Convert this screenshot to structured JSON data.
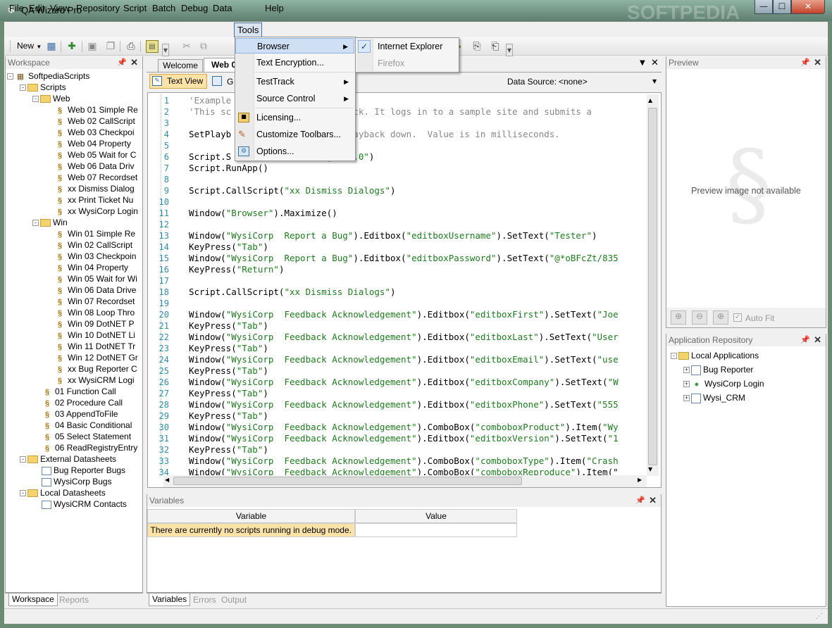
{
  "window": {
    "title": "QA Wizard Pro",
    "watermark": "SOFTPEDIA"
  },
  "menubar": [
    "File",
    "Edit",
    "View",
    "Repository",
    "Script",
    "Batch",
    "Debug",
    "Data",
    "Tools",
    "Help"
  ],
  "toolbar": {
    "new_label": "New"
  },
  "workspace": {
    "title": "Workspace",
    "tabs": [
      "Workspace",
      "Reports"
    ],
    "tree": [
      {
        "label": "SoftpediaScripts",
        "level": 0,
        "icon": "project",
        "exp": "-"
      },
      {
        "label": "Scripts",
        "level": 1,
        "icon": "folder",
        "exp": "-"
      },
      {
        "label": "Web",
        "level": 2,
        "icon": "folder",
        "exp": "-"
      },
      {
        "label": "Web 01 Simple Re",
        "level": 3,
        "icon": "script"
      },
      {
        "label": "Web 02 CallScript",
        "level": 3,
        "icon": "script"
      },
      {
        "label": "Web 03 Checkpoi",
        "level": 3,
        "icon": "script"
      },
      {
        "label": "Web 04 Property",
        "level": 3,
        "icon": "script"
      },
      {
        "label": "Web 05 Wait for C",
        "level": 3,
        "icon": "script"
      },
      {
        "label": "Web 06 Data Driv",
        "level": 3,
        "icon": "script"
      },
      {
        "label": "Web 07 Recordset",
        "level": 3,
        "icon": "script"
      },
      {
        "label": "xx Dismiss Dialog",
        "level": 3,
        "icon": "script"
      },
      {
        "label": "xx Print Ticket Nu",
        "level": 3,
        "icon": "script"
      },
      {
        "label": "xx WysiCorp Login",
        "level": 3,
        "icon": "script"
      },
      {
        "label": "Win",
        "level": 2,
        "icon": "folder",
        "exp": "-"
      },
      {
        "label": "Win 01 Simple Re",
        "level": 3,
        "icon": "script"
      },
      {
        "label": "Win 02 CallScript",
        "level": 3,
        "icon": "script"
      },
      {
        "label": "Win 03 Checkpoin",
        "level": 3,
        "icon": "script"
      },
      {
        "label": "Win 04 Property",
        "level": 3,
        "icon": "script"
      },
      {
        "label": "Win 05 Wait for Wi",
        "level": 3,
        "icon": "script"
      },
      {
        "label": "Win 06 Data Drive",
        "level": 3,
        "icon": "script"
      },
      {
        "label": "Win 07 Recordset",
        "level": 3,
        "icon": "script"
      },
      {
        "label": "Win 08 Loop Thro",
        "level": 3,
        "icon": "script"
      },
      {
        "label": "Win 09 DotNET P",
        "level": 3,
        "icon": "script"
      },
      {
        "label": "Win 10 DotNET Li",
        "level": 3,
        "icon": "script"
      },
      {
        "label": "Win 11 DotNET Tr",
        "level": 3,
        "icon": "script"
      },
      {
        "label": "Win 12 DotNET Gr",
        "level": 3,
        "icon": "script"
      },
      {
        "label": "xx Bug Reporter C",
        "level": 3,
        "icon": "script"
      },
      {
        "label": "xx WysiCRM Logi",
        "level": 3,
        "icon": "script"
      },
      {
        "label": "01 Function Call",
        "level": 2,
        "icon": "script"
      },
      {
        "label": "02 Procedure Call",
        "level": 2,
        "icon": "script"
      },
      {
        "label": "03 AppendToFile",
        "level": 2,
        "icon": "script"
      },
      {
        "label": "04 Basic Conditional",
        "level": 2,
        "icon": "script"
      },
      {
        "label": "05 Select Statement",
        "level": 2,
        "icon": "script"
      },
      {
        "label": "06 ReadRegistryEntry",
        "level": 2,
        "icon": "script"
      },
      {
        "label": "External Datasheets",
        "level": 1,
        "icon": "folder",
        "exp": "-"
      },
      {
        "label": "Bug Reporter Bugs",
        "level": 2,
        "icon": "datasheet"
      },
      {
        "label": "WysiCorp Bugs",
        "level": 2,
        "icon": "datasheet"
      },
      {
        "label": "Local Datasheets",
        "level": 1,
        "icon": "folder",
        "exp": "-"
      },
      {
        "label": "WysiCRM Contacts",
        "level": 2,
        "icon": "datasheet"
      }
    ]
  },
  "editor": {
    "tabs": [
      "Welcome",
      "Web 0"
    ],
    "view_tabs": [
      "Text View",
      "G"
    ],
    "data_source_label": "Data Source:",
    "data_source_value": "<none>",
    "lines": [
      {
        "n": "1",
        "parts": [
          [
            "cmt",
            "'Example"
          ]
        ]
      },
      {
        "n": "2",
        "parts": [
          [
            "cmt",
            "'This sc"
          ],
          [
            "cmt",
            "                 playback. It logs in to a sample site and submits a"
          ]
        ]
      },
      {
        "n": "3",
        "parts": []
      },
      {
        "n": "4",
        "parts": [
          [
            "",
            "SetPlayb"
          ],
          [
            "cmt",
            "                 ows playback down.  Value is in milliseconds."
          ]
        ]
      },
      {
        "n": "5",
        "parts": []
      },
      {
        "n": "6",
        "parts": [
          [
            "",
            "Script.S"
          ],
          [
            "str",
            "                 ogin/1.0\""
          ],
          [
            "",
            ")"
          ]
        ]
      },
      {
        "n": "7",
        "parts": [
          [
            "",
            "Script.RunApp()"
          ]
        ]
      },
      {
        "n": "8",
        "parts": []
      },
      {
        "n": "9",
        "parts": [
          [
            "",
            "Script.CallScript("
          ],
          [
            "str",
            "\"xx Dismiss Dialogs\""
          ],
          [
            "",
            ")"
          ]
        ]
      },
      {
        "n": "10",
        "parts": []
      },
      {
        "n": "11",
        "parts": [
          [
            "",
            "Window("
          ],
          [
            "str",
            "\"Browser\""
          ],
          [
            "",
            ").Maximize()"
          ]
        ]
      },
      {
        "n": "12",
        "parts": []
      },
      {
        "n": "13",
        "parts": [
          [
            "",
            "Window("
          ],
          [
            "str",
            "\"WysiCorp  Report a Bug\""
          ],
          [
            "",
            ").Editbox("
          ],
          [
            "str",
            "\"editboxUsername\""
          ],
          [
            "",
            ").SetText("
          ],
          [
            "str",
            "\"Tester\""
          ],
          [
            "",
            ")"
          ]
        ]
      },
      {
        "n": "14",
        "parts": [
          [
            "",
            "KeyPress("
          ],
          [
            "str",
            "\"Tab\""
          ],
          [
            "",
            ")"
          ]
        ]
      },
      {
        "n": "15",
        "parts": [
          [
            "",
            "Window("
          ],
          [
            "str",
            "\"WysiCorp  Report a Bug\""
          ],
          [
            "",
            ").Editbox("
          ],
          [
            "str",
            "\"editboxPassword\""
          ],
          [
            "",
            ").SetText("
          ],
          [
            "str",
            "\"@*oBFcZt/835"
          ]
        ]
      },
      {
        "n": "16",
        "parts": [
          [
            "",
            "KeyPress("
          ],
          [
            "str",
            "\"Return\""
          ],
          [
            "",
            ")"
          ]
        ]
      },
      {
        "n": "17",
        "parts": []
      },
      {
        "n": "18",
        "parts": [
          [
            "",
            "Script.CallScript("
          ],
          [
            "str",
            "\"xx Dismiss Dialogs\""
          ],
          [
            "",
            ")"
          ]
        ]
      },
      {
        "n": "19",
        "parts": []
      },
      {
        "n": "20",
        "parts": [
          [
            "",
            "Window("
          ],
          [
            "str",
            "\"WysiCorp  Feedback Acknowledgement\""
          ],
          [
            "",
            ").Editbox("
          ],
          [
            "str",
            "\"editboxFirst\""
          ],
          [
            "",
            ").SetText("
          ],
          [
            "str",
            "\"Joe"
          ]
        ]
      },
      {
        "n": "21",
        "parts": [
          [
            "",
            "KeyPress("
          ],
          [
            "str",
            "\"Tab\""
          ],
          [
            "",
            ")"
          ]
        ]
      },
      {
        "n": "22",
        "parts": [
          [
            "",
            "Window("
          ],
          [
            "str",
            "\"WysiCorp  Feedback Acknowledgement\""
          ],
          [
            "",
            ").Editbox("
          ],
          [
            "str",
            "\"editboxLast\""
          ],
          [
            "",
            ").SetText("
          ],
          [
            "str",
            "\"User"
          ]
        ]
      },
      {
        "n": "23",
        "parts": [
          [
            "",
            "KeyPress("
          ],
          [
            "str",
            "\"Tab\""
          ],
          [
            "",
            ")"
          ]
        ]
      },
      {
        "n": "24",
        "parts": [
          [
            "",
            "Window("
          ],
          [
            "str",
            "\"WysiCorp  Feedback Acknowledgement\""
          ],
          [
            "",
            ").Editbox("
          ],
          [
            "str",
            "\"editboxEmail\""
          ],
          [
            "",
            ").SetText("
          ],
          [
            "str",
            "\"use"
          ]
        ]
      },
      {
        "n": "25",
        "parts": [
          [
            "",
            "KeyPress("
          ],
          [
            "str",
            "\"Tab\""
          ],
          [
            "",
            ")"
          ]
        ]
      },
      {
        "n": "26",
        "parts": [
          [
            "",
            "Window("
          ],
          [
            "str",
            "\"WysiCorp  Feedback Acknowledgement\""
          ],
          [
            "",
            ").Editbox("
          ],
          [
            "str",
            "\"editboxCompany\""
          ],
          [
            "",
            ").SetText("
          ],
          [
            "str",
            "\"W"
          ]
        ]
      },
      {
        "n": "27",
        "parts": [
          [
            "",
            "KeyPress("
          ],
          [
            "str",
            "\"Tab\""
          ],
          [
            "",
            ")"
          ]
        ]
      },
      {
        "n": "28",
        "parts": [
          [
            "",
            "Window("
          ],
          [
            "str",
            "\"WysiCorp  Feedback Acknowledgement\""
          ],
          [
            "",
            ").Editbox("
          ],
          [
            "str",
            "\"editboxPhone\""
          ],
          [
            "",
            ").SetText("
          ],
          [
            "str",
            "\"555"
          ]
        ]
      },
      {
        "n": "29",
        "parts": [
          [
            "",
            "KeyPress("
          ],
          [
            "str",
            "\"Tab\""
          ],
          [
            "",
            ")"
          ]
        ]
      },
      {
        "n": "30",
        "parts": [
          [
            "",
            "Window("
          ],
          [
            "str",
            "\"WysiCorp  Feedback Acknowledgement\""
          ],
          [
            "",
            ").ComboBox("
          ],
          [
            "str",
            "\"comboboxProduct\""
          ],
          [
            "",
            ").Item("
          ],
          [
            "str",
            "\"Wy"
          ]
        ]
      },
      {
        "n": "31",
        "parts": [
          [
            "",
            "Window("
          ],
          [
            "str",
            "\"WysiCorp  Feedback Acknowledgement\""
          ],
          [
            "",
            ").Editbox("
          ],
          [
            "str",
            "\"editboxVersion\""
          ],
          [
            "",
            ").SetText("
          ],
          [
            "str",
            "\"1"
          ]
        ]
      },
      {
        "n": "32",
        "parts": [
          [
            "",
            "KeyPress("
          ],
          [
            "str",
            "\"Tab\""
          ],
          [
            "",
            ")"
          ]
        ]
      },
      {
        "n": "33",
        "parts": [
          [
            "",
            "Window("
          ],
          [
            "str",
            "\"WysiCorp  Feedback Acknowledgement\""
          ],
          [
            "",
            ").ComboBox("
          ],
          [
            "str",
            "\"comboboxType\""
          ],
          [
            "",
            ").Item("
          ],
          [
            "str",
            "\"Crash"
          ]
        ]
      },
      {
        "n": "34",
        "parts": [
          [
            "",
            "Window("
          ],
          [
            "str",
            "\"WysiCorp  Feedback Acknowledgement\""
          ],
          [
            "",
            ").ComboBox("
          ],
          [
            "str",
            "\"comboboxReproduce\""
          ],
          [
            "",
            ").Item(\""
          ]
        ]
      }
    ]
  },
  "variables": {
    "title": "Variables",
    "headers": [
      "Variable",
      "Value"
    ],
    "message": "There are currently no scripts running in debug mode.",
    "tabs": [
      "Variables",
      "Errors",
      "Output"
    ]
  },
  "preview": {
    "title": "Preview",
    "message": "Preview image not available",
    "autofit": "Auto Fit"
  },
  "repository": {
    "title": "Application Repository",
    "items": [
      {
        "label": "Local Applications",
        "level": 0,
        "icon": "folder",
        "exp": "-"
      },
      {
        "label": "Bug Reporter",
        "level": 1,
        "icon": "window",
        "exp": "+"
      },
      {
        "label": "WysiCorp Login",
        "level": 1,
        "icon": "globe",
        "exp": "+"
      },
      {
        "label": "Wysi_CRM",
        "level": 1,
        "icon": "window",
        "exp": "+"
      }
    ]
  },
  "tools_menu": {
    "items": [
      "Browser",
      "Text Encryption...",
      "TestTrack",
      "Source Control",
      "Licensing...",
      "Customize Toolbars...",
      "Options..."
    ],
    "browser_submenu": [
      "Internet Explorer",
      "Firefox"
    ]
  },
  "colors": {
    "menu_highlight": "#cfe0f5",
    "code_string": "#1a7f1a",
    "line_number": "#2b91af"
  }
}
